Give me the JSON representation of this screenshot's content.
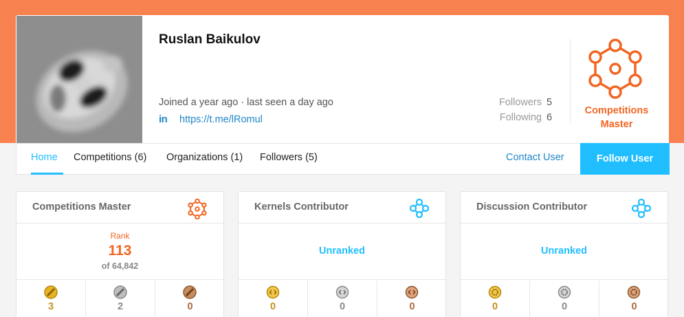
{
  "profile": {
    "name": "Ruslan Baikulov",
    "joined": "Joined a year ago · last seen a day ago",
    "linkedin_label": "in",
    "url": "https://t.me/lRomul",
    "followers_label": "Followers",
    "followers_count": "5",
    "following_label": "Following",
    "following_count": "6",
    "tier_icon": "competitions-master-icon",
    "tier_line1": "Competitions",
    "tier_line2": "Master"
  },
  "nav": {
    "tabs": [
      {
        "label": "Home"
      },
      {
        "label": "Competitions (6)"
      },
      {
        "label": "Organizations (1)"
      },
      {
        "label": "Followers (5)"
      }
    ],
    "contact": "Contact User",
    "follow": "Follow User"
  },
  "colors": {
    "brand_orange": "#f8824f",
    "accent_blue": "#20beff",
    "tier_orange": "#f26522",
    "gold": "#d5a02a",
    "silver": "#999999",
    "bronze": "#a86a3e"
  },
  "cards": [
    {
      "title": "Competitions Master",
      "icon": "competitions-tier-icon",
      "rank_label": "Rank",
      "rank": "113",
      "rank_of": "of 64,842",
      "medals": [
        "3",
        "2",
        "0"
      ]
    },
    {
      "title": "Kernels Contributor",
      "icon": "kernels-tier-icon",
      "status": "Unranked",
      "medals": [
        "0",
        "0",
        "0"
      ]
    },
    {
      "title": "Discussion Contributor",
      "icon": "discussion-tier-icon",
      "status": "Unranked",
      "medals": [
        "0",
        "0",
        "0"
      ]
    }
  ]
}
